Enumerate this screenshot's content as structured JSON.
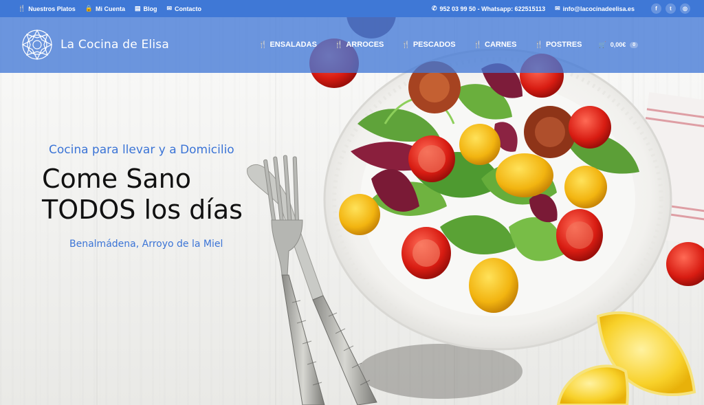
{
  "topbar": {
    "links": [
      {
        "icon": "fork-knife-icon",
        "glyph": "🍴",
        "label": "Nuestros Platos"
      },
      {
        "icon": "lock-icon",
        "glyph": "🔒",
        "label": "Mi Cuenta"
      },
      {
        "icon": "document-icon",
        "glyph": "▤",
        "label": "Blog"
      },
      {
        "icon": "envelope-icon",
        "glyph": "✉",
        "label": "Contacto"
      }
    ],
    "phone": "952 03 99 50 - Whatsapp: 622515113",
    "email": "info@lacocinadeelisa.es",
    "social": [
      {
        "icon": "facebook-icon",
        "glyph": "f"
      },
      {
        "icon": "twitter-icon",
        "glyph": "t"
      },
      {
        "icon": "instagram-icon",
        "glyph": "◎"
      }
    ]
  },
  "brand": {
    "name": "La Cocina de Elisa"
  },
  "nav": {
    "items": [
      {
        "label": "ENSALADAS"
      },
      {
        "label": "ARROCES"
      },
      {
        "label": "PESCADOS"
      },
      {
        "label": "CARNES"
      },
      {
        "label": "POSTRES"
      }
    ],
    "cart_total": "0,00€",
    "cart_count": "0"
  },
  "hero": {
    "subtitle": "Cocina para llevar y a Domicilio",
    "title_line1": "Come Sano",
    "title_line2": "TODOS los días",
    "location": "Benalmádena, Arroyo de la Miel"
  },
  "colors": {
    "brand_blue": "#3f78d6",
    "accent_text_blue": "#3b74d6"
  }
}
